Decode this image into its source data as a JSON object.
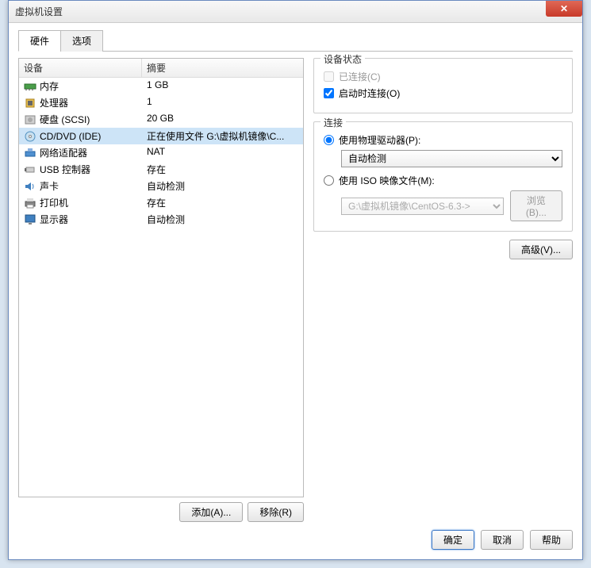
{
  "window": {
    "title": "虚拟机设置"
  },
  "tabs": {
    "hardware": "硬件",
    "options": "选项"
  },
  "headers": {
    "device": "设备",
    "summary": "摘要"
  },
  "hw": [
    {
      "icon": "memory",
      "name": "内存",
      "summary": "1 GB",
      "sel": false
    },
    {
      "icon": "cpu",
      "name": "处理器",
      "summary": "1",
      "sel": false
    },
    {
      "icon": "disk",
      "name": "硬盘 (SCSI)",
      "summary": "20 GB",
      "sel": false
    },
    {
      "icon": "cd",
      "name": "CD/DVD (IDE)",
      "summary": "正在使用文件 G:\\虚拟机镜像\\C...",
      "sel": true
    },
    {
      "icon": "net",
      "name": "网络适配器",
      "summary": "NAT",
      "sel": false
    },
    {
      "icon": "usb",
      "name": "USB 控制器",
      "summary": "存在",
      "sel": false
    },
    {
      "icon": "sound",
      "name": "声卡",
      "summary": "自动检测",
      "sel": false
    },
    {
      "icon": "printer",
      "name": "打印机",
      "summary": "存在",
      "sel": false
    },
    {
      "icon": "display",
      "name": "显示器",
      "summary": "自动检测",
      "sel": false
    }
  ],
  "leftButtons": {
    "add": "添加(A)...",
    "remove": "移除(R)"
  },
  "status": {
    "groupTitle": "设备状态",
    "connected": "已连接(C)",
    "connectAtPowerOn": "启动时连接(O)"
  },
  "connection": {
    "groupTitle": "连接",
    "usePhysical": "使用物理驱动器(P):",
    "physicalOption": "自动检测",
    "useIso": "使用 ISO 映像文件(M):",
    "isoPath": "G:\\虚拟机镜像\\CentOS-6.3->",
    "browse": "浏览(B)..."
  },
  "advanced": "高级(V)...",
  "footer": {
    "ok": "确定",
    "cancel": "取消",
    "help": "帮助"
  }
}
